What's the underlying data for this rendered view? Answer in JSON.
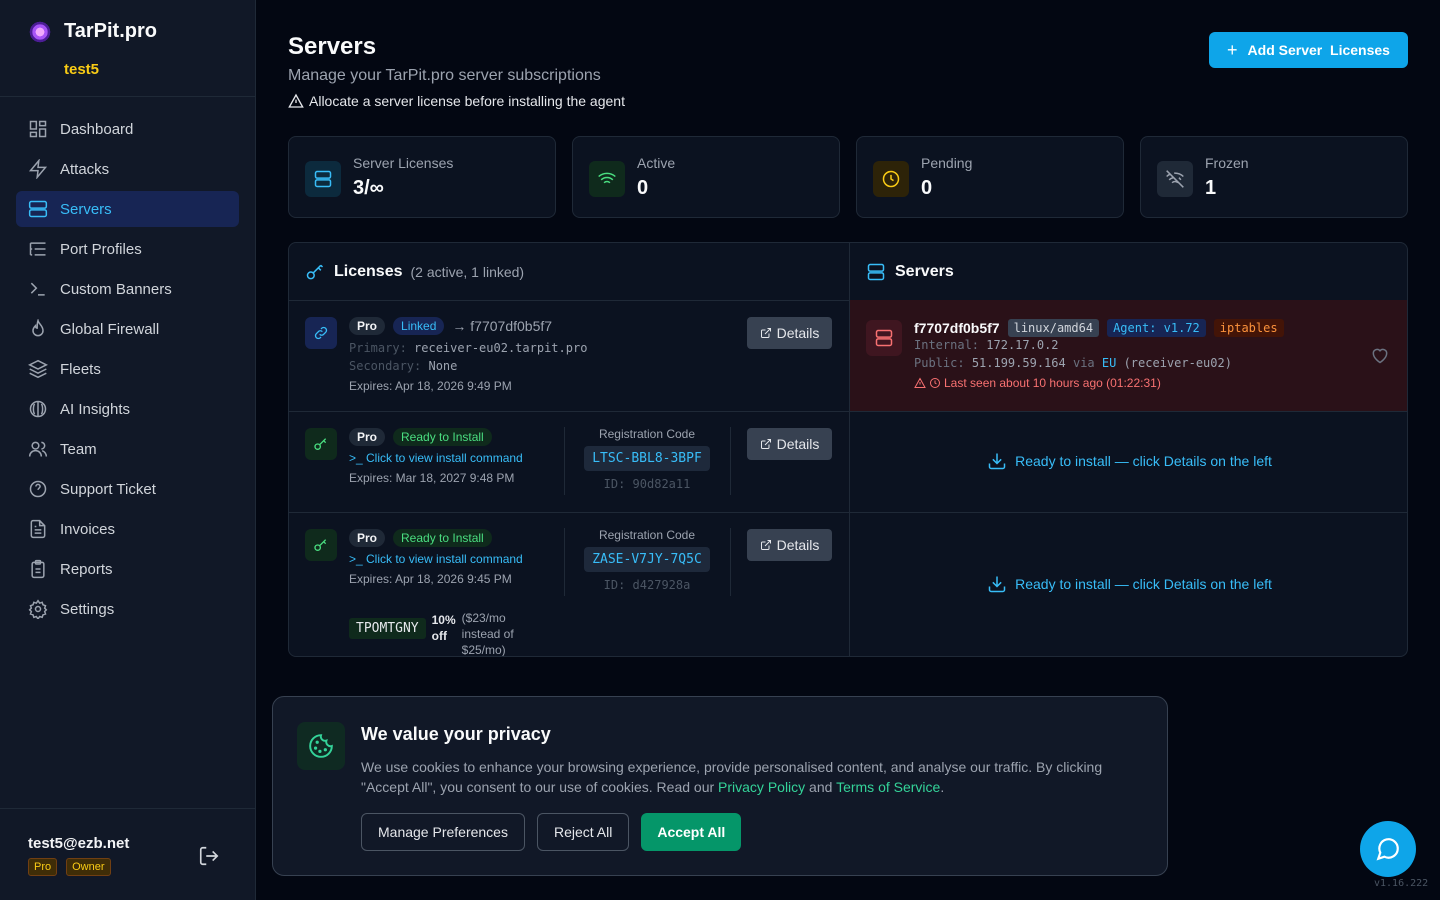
{
  "brand": {
    "name": "TarPit.pro",
    "user": "test5"
  },
  "nav": [
    {
      "label": "Dashboard",
      "icon": "grid-icon"
    },
    {
      "label": "Attacks",
      "icon": "bolt-icon"
    },
    {
      "label": "Servers",
      "icon": "server-icon",
      "active": true
    },
    {
      "label": "Port Profiles",
      "icon": "list-tree-icon"
    },
    {
      "label": "Custom Banners",
      "icon": "terminal-icon"
    },
    {
      "label": "Global Firewall",
      "icon": "flame-icon"
    },
    {
      "label": "Fleets",
      "icon": "layers-icon"
    },
    {
      "label": "AI Insights",
      "icon": "brain-icon"
    },
    {
      "label": "Team",
      "icon": "users-icon"
    },
    {
      "label": "Support Ticket",
      "icon": "help-circle-icon"
    },
    {
      "label": "Invoices",
      "icon": "file-text-icon"
    },
    {
      "label": "Reports",
      "icon": "clipboard-icon"
    },
    {
      "label": "Settings",
      "icon": "gear-icon"
    }
  ],
  "account": {
    "email": "test5@ezb.net",
    "plan": "Pro",
    "role": "Owner"
  },
  "header": {
    "title": "Servers",
    "subtitle": "Manage your TarPit.pro server subscriptions",
    "warning": "Allocate a server license before installing the agent",
    "add_button": "Add Server  Licenses"
  },
  "stats": [
    {
      "label": "Server Licenses",
      "value": "3/∞",
      "color": "#38bdf8"
    },
    {
      "label": "Active",
      "value": "0",
      "color": "#4ade80"
    },
    {
      "label": "Pending",
      "value": "0",
      "color": "#facc15"
    },
    {
      "label": "Frozen",
      "value": "1",
      "color": "#9ca3af"
    }
  ],
  "licenses_panel": {
    "title": "Licenses",
    "summary": "(2 active, 1 linked)"
  },
  "servers_panel": {
    "title": "Servers"
  },
  "licenses": [
    {
      "plan": "Pro",
      "status": "Linked",
      "linked_to": "→ f7707df0b5f7",
      "primary_label": "Primary:",
      "primary": "receiver-eu02.tarpit.pro",
      "secondary_label": "Secondary:",
      "secondary": "None",
      "expires": "Expires: Apr 18, 2026 9:49 PM",
      "details": "Details"
    },
    {
      "plan": "Pro",
      "status": "Ready to Install",
      "install_link": "Click to view install command",
      "expires": "Expires: Mar 18, 2027 9:48 PM",
      "reg_label": "Registration Code",
      "reg_code": "LTSC-BBL8-3BPF",
      "reg_id": "ID: 90d82a11",
      "details": "Details"
    },
    {
      "plan": "Pro",
      "status": "Ready to Install",
      "install_link": "Click to view install command",
      "expires": "Expires: Apr 18, 2026 9:45 PM",
      "reg_label": "Registration Code",
      "reg_code": "ZASE-V7JY-7Q5C",
      "reg_id": "ID: d427928a",
      "details": "Details",
      "promo_code": "TPOMTGNY",
      "promo_pct": "10%",
      "promo_off": "off",
      "promo_note_1": "($23/mo",
      "promo_note_2": "instead of",
      "promo_note_3": "$25/mo)"
    }
  ],
  "server": {
    "name": "f7707df0b5f7",
    "arch": "linux/amd64",
    "agent": "Agent: v1.72",
    "firewall": "iptables",
    "internal_label": "Internal:",
    "internal": "172.17.0.2",
    "public_label": "Public:",
    "public": "51.199.59.164",
    "via": "via",
    "region": "EU",
    "receiver": "(receiver-eu02)",
    "last_seen": "Last seen about 10 hours ago (01:22:31)"
  },
  "ready_rows": [
    "Ready to install — click Details on the left",
    "Ready to install — click Details on the left"
  ],
  "cookie": {
    "title": "We value your privacy",
    "text_1": "We use cookies to enhance your browsing experience, provide personalised content, and analyse our traffic. By clicking \"Accept All\", you consent to our use of cookies. Read our ",
    "privacy_link": "Privacy Policy",
    "and": " and ",
    "terms_link": "Terms of Service",
    "period": ".",
    "manage": "Manage Preferences",
    "reject": "Reject All",
    "accept": "Accept All"
  },
  "version": "v1.16.222"
}
